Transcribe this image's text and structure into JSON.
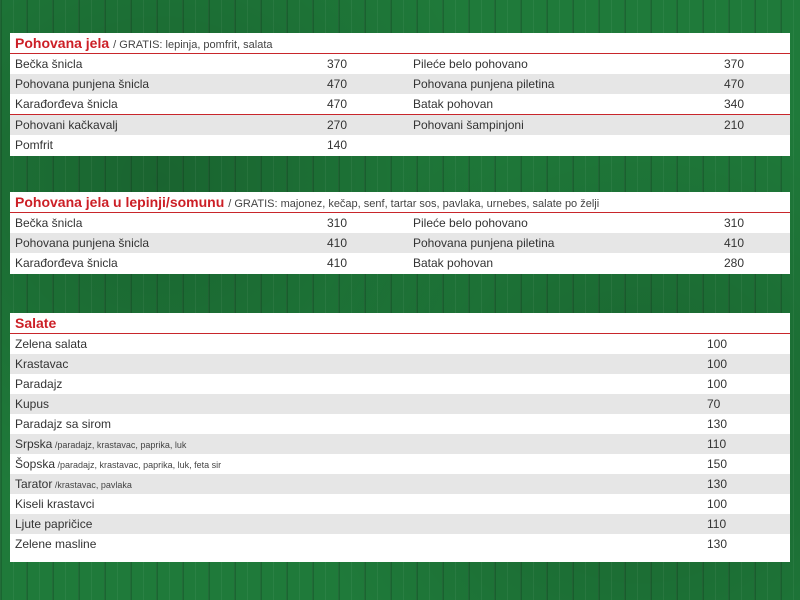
{
  "section1": {
    "title": "Pohovana jela",
    "subtitle": "/ GRATIS: lepinja, pomfrit, salata",
    "rows": [
      {
        "name1": "Bečka šnicla",
        "price1": "370",
        "name2": "Pileće belo pohovano",
        "price2": "370"
      },
      {
        "name1": "Pohovana punjena šnicla",
        "price1": "470",
        "name2": "Pohovana punjena piletina",
        "price2": "470"
      },
      {
        "name1": "Karađorđeva šnicla",
        "price1": "470",
        "name2": "Batak pohovan",
        "price2": "340"
      },
      {
        "name1": "Pohovani kačkavalj",
        "price1": "270",
        "name2": "Pohovani šampinjoni",
        "price2": "210"
      },
      {
        "name1": "Pomfrit",
        "price1": "140",
        "name2": "",
        "price2": ""
      }
    ]
  },
  "section2": {
    "title": "Pohovana jela u lepinji/somunu",
    "subtitle": "/ GRATIS: majonez, kečap, senf, tartar sos, pavlaka, urnebes, salate po želji",
    "rows": [
      {
        "name1": "Bečka šnicla",
        "price1": "310",
        "name2": "Pileće belo pohovano",
        "price2": "310"
      },
      {
        "name1": "Pohovana punjena šnicla",
        "price1": "410",
        "name2": "Pohovana punjena piletina",
        "price2": "410"
      },
      {
        "name1": "Karađorđeva šnicla",
        "price1": "410",
        "name2": "Batak pohovan",
        "price2": "280"
      }
    ]
  },
  "section3": {
    "title": "Salate",
    "rows": [
      {
        "name": "Zelena salata",
        "note": "",
        "price": "100"
      },
      {
        "name": "Krastavac",
        "note": "",
        "price": "100"
      },
      {
        "name": "Paradajz",
        "note": "",
        "price": "100"
      },
      {
        "name": "Kupus",
        "note": "",
        "price": "70"
      },
      {
        "name": "Paradajz sa sirom",
        "note": "",
        "price": "130"
      },
      {
        "name": "Srpska",
        "note": " /paradajz, krastavac, paprika, luk",
        "price": "110"
      },
      {
        "name": "Šopska",
        "note": " /paradajz, krastavac, paprika, luk, feta sir",
        "price": "150"
      },
      {
        "name": "Tarator",
        "note": " /krastavac, pavlaka",
        "price": "130"
      },
      {
        "name": "Kiseli krastavci",
        "note": "",
        "price": "100"
      },
      {
        "name": "Ljute papričice",
        "note": "",
        "price": "110"
      },
      {
        "name": "Zelene masline",
        "note": "",
        "price": "130"
      }
    ]
  }
}
